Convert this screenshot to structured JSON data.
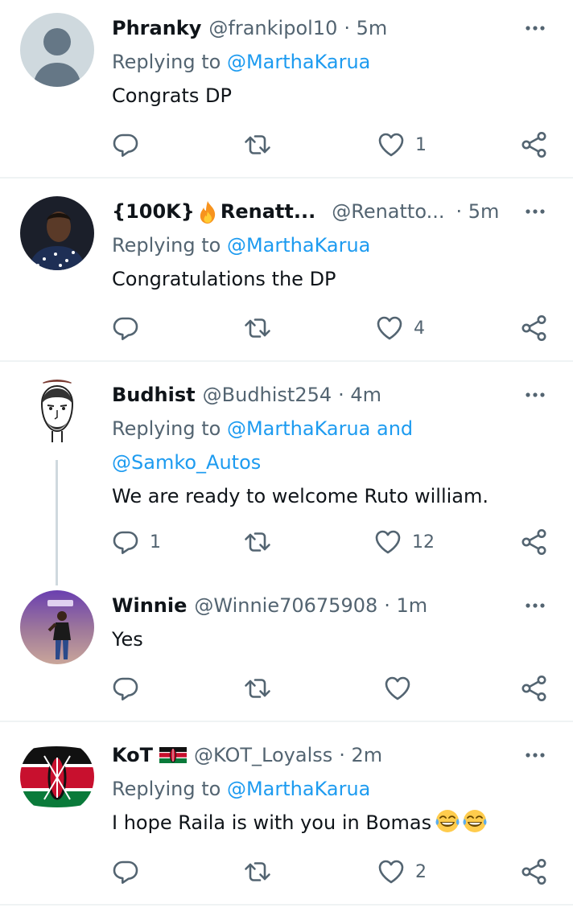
{
  "tweets": [
    {
      "name": "Phranky",
      "handle": "@frankipol10",
      "time": "· 5m",
      "reply_prefix": "Replying to",
      "mentions": "@MarthaKarua",
      "text": "Congrats DP",
      "counts": {
        "reply": "",
        "retweet": "",
        "like": "1"
      },
      "avatar": "default-avatar"
    },
    {
      "name_prefix": "{100K}",
      "name_suffix": "Renatt...",
      "handle": "@Renatto...",
      "time": "· 5m",
      "reply_prefix": "Replying to",
      "mentions": "@MarthaKarua",
      "text": "Congratulations the DP",
      "counts": {
        "reply": "",
        "retweet": "",
        "like": "4"
      },
      "avatar": "photo-avatar"
    },
    {
      "name": "Budhist",
      "handle": "@Budhist254",
      "time": "· 4m",
      "reply_prefix": "Replying to",
      "mentions": "@MarthaKarua and",
      "mentions_2": "@Samko_Autos",
      "text": "We are ready to welcome Ruto william.",
      "counts": {
        "reply": "1",
        "retweet": "",
        "like": "12"
      },
      "avatar": "drawn-face-avatar"
    },
    {
      "name": "Winnie",
      "handle": "@Winnie70675908",
      "time": "· 1m",
      "text": "Yes",
      "counts": {
        "reply": "",
        "retweet": "",
        "like": ""
      },
      "avatar": "photo-avatar"
    },
    {
      "name": "KoT",
      "handle": "@KOT_Loyalss",
      "time": "· 2m",
      "reply_prefix": "Replying to",
      "mentions": "@MarthaKarua",
      "text": "I hope Raila is with you in Bomas",
      "counts": {
        "reply": "",
        "retweet": "",
        "like": "2"
      },
      "avatar": "kenya-flag-avatar"
    }
  ],
  "colors": {
    "accent": "#1d9bf0",
    "secondary_text": "#536471",
    "divider": "#eff3f4"
  },
  "icons": [
    "more-icon",
    "reply-icon",
    "retweet-icon",
    "like-icon",
    "share-icon",
    "flame-icon",
    "kenya-flag-icon",
    "laughing-emoji-icon"
  ]
}
